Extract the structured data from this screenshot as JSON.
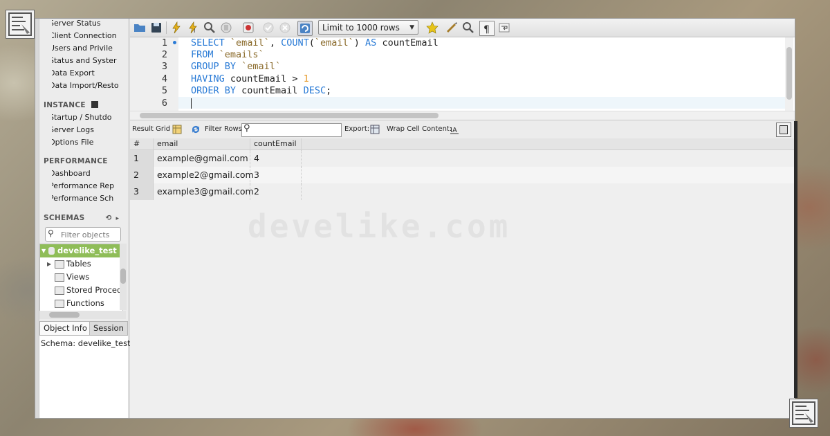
{
  "sidebar": {
    "management": [
      {
        "label": "Server Status",
        "icon": "server-status-icon"
      },
      {
        "label": "Client Connection",
        "icon": "client-connections-icon"
      },
      {
        "label": "Users and Privile",
        "icon": "users-icon"
      },
      {
        "label": "Status and Syster",
        "icon": "status-variables-icon"
      },
      {
        "label": "Data Export",
        "icon": "data-export-icon"
      },
      {
        "label": "Data Import/Resto",
        "icon": "data-import-icon"
      }
    ],
    "instance_title": "INSTANCE",
    "instance": [
      {
        "label": "Startup / Shutdo",
        "icon": "startup-icon"
      },
      {
        "label": "Server Logs",
        "icon": "server-logs-icon"
      },
      {
        "label": "Options File",
        "icon": "wrench-icon"
      }
    ],
    "performance_title": "PERFORMANCE",
    "performance": [
      {
        "label": "Dashboard",
        "icon": "dashboard-icon"
      },
      {
        "label": "Performance Rep",
        "icon": "performance-reports-icon"
      },
      {
        "label": "Performance Sch",
        "icon": "performance-schema-icon"
      }
    ],
    "schemas_title": "SCHEMAS",
    "filter_placeholder": "Filter objects",
    "schema_tree": {
      "selected": "develike_test",
      "children": [
        "Tables",
        "Views",
        "Stored Proced",
        "Functions"
      ]
    },
    "tabs": [
      "Object Info",
      "Session"
    ],
    "info_text": "Schema: develike_test"
  },
  "toolbar": {
    "limit_value": "Limit to 1000 rows"
  },
  "editor": {
    "line_numbers": [
      "1",
      "2",
      "3",
      "4",
      "5",
      "6"
    ]
  },
  "result_toolbar": {
    "result_grid": "Result Grid",
    "filter_rows": "Filter Rows:",
    "export": "Export:",
    "wrap": "Wrap Cell Content:"
  },
  "grid": {
    "columns": [
      "#",
      "email",
      "countEmail"
    ],
    "rows": [
      {
        "n": "1",
        "email": "example@gmail.com",
        "count": "4"
      },
      {
        "n": "2",
        "email": "example2@gmail.com",
        "count": "3"
      },
      {
        "n": "3",
        "email": "example3@gmail.com",
        "count": "2"
      }
    ]
  },
  "watermark": "develike.com",
  "colors": {
    "selected_schema_bg": "#8fbd58",
    "keyword": "#2a7bd6",
    "string": "#8a6a2a",
    "number": "#e59a2a"
  }
}
